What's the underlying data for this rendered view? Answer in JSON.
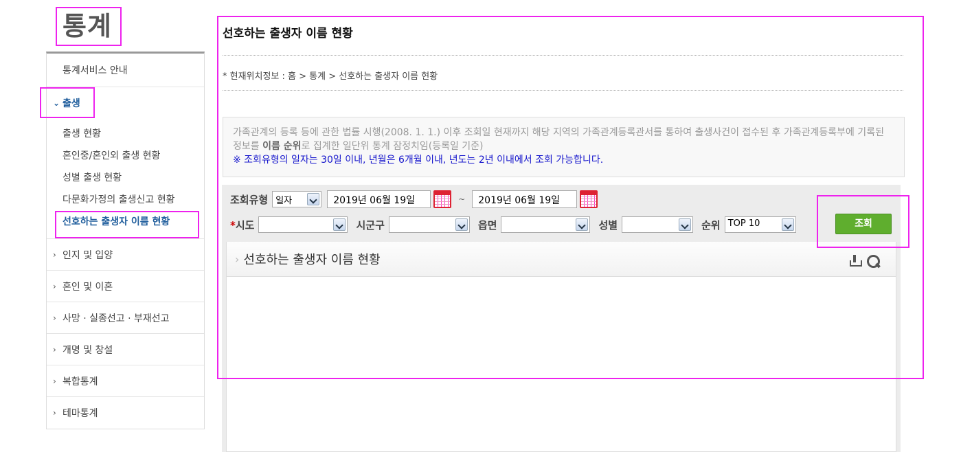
{
  "brand": "통계",
  "sidebar": {
    "top_item": "통계서비스 안내",
    "active_section": "출생",
    "sub_items": [
      "출생 현황",
      "혼인중/혼인외 출생 현황",
      "성별 출생 현황",
      "다문화가정의 출생신고 현황",
      "선호하는 출생자 이름 현황"
    ],
    "sections": [
      "인지 및 입양",
      "혼인 및 이혼",
      "사망 · 실종선고 · 부재선고",
      "개명 및 창설",
      "복합통계",
      "테마통계"
    ]
  },
  "page": {
    "title": "선호하는 출생자 이름 현황",
    "breadcrumb": "* 현재위치정보 : 홈 > 통계 > 선호하는 출생자 이름 현황"
  },
  "notice": {
    "line1_pre": "가족관계의 등록 등에 관한 법률 시행(2008. 1. 1.) 이후 조회일 현재까지 해당 지역의 가족관계등록관서를 통하여 출생사건이 접수된 후 가족관계등록부에 기록된 정보를 ",
    "line1_bold": "이름 순위",
    "line1_post": "로 집계한 일단위 통계 잠정치임(등록일 기준)",
    "line2": "※ 조회유형의 일자는 30일 이내, 년월은 6개월 이내, 년도는 2년 이내에서 조회 가능합니다."
  },
  "search": {
    "type_label": "조회유형",
    "type_value": "일자",
    "date_from": "2019년 06월 19일",
    "tilde": "~",
    "date_to": "2019년 06월 19일",
    "sido_star": "*",
    "sido_label": "시도",
    "sido_value": "",
    "sigungu_label": "시군구",
    "sigungu_value": "",
    "eupmyeon_label": "읍면",
    "eupmyeon_value": "",
    "gender_label": "성별",
    "gender_value": "",
    "rank_label": "순위",
    "rank_value": "TOP 10",
    "submit_label": "조회"
  },
  "panel": {
    "title": "선호하는 출생자 이름 현황"
  }
}
